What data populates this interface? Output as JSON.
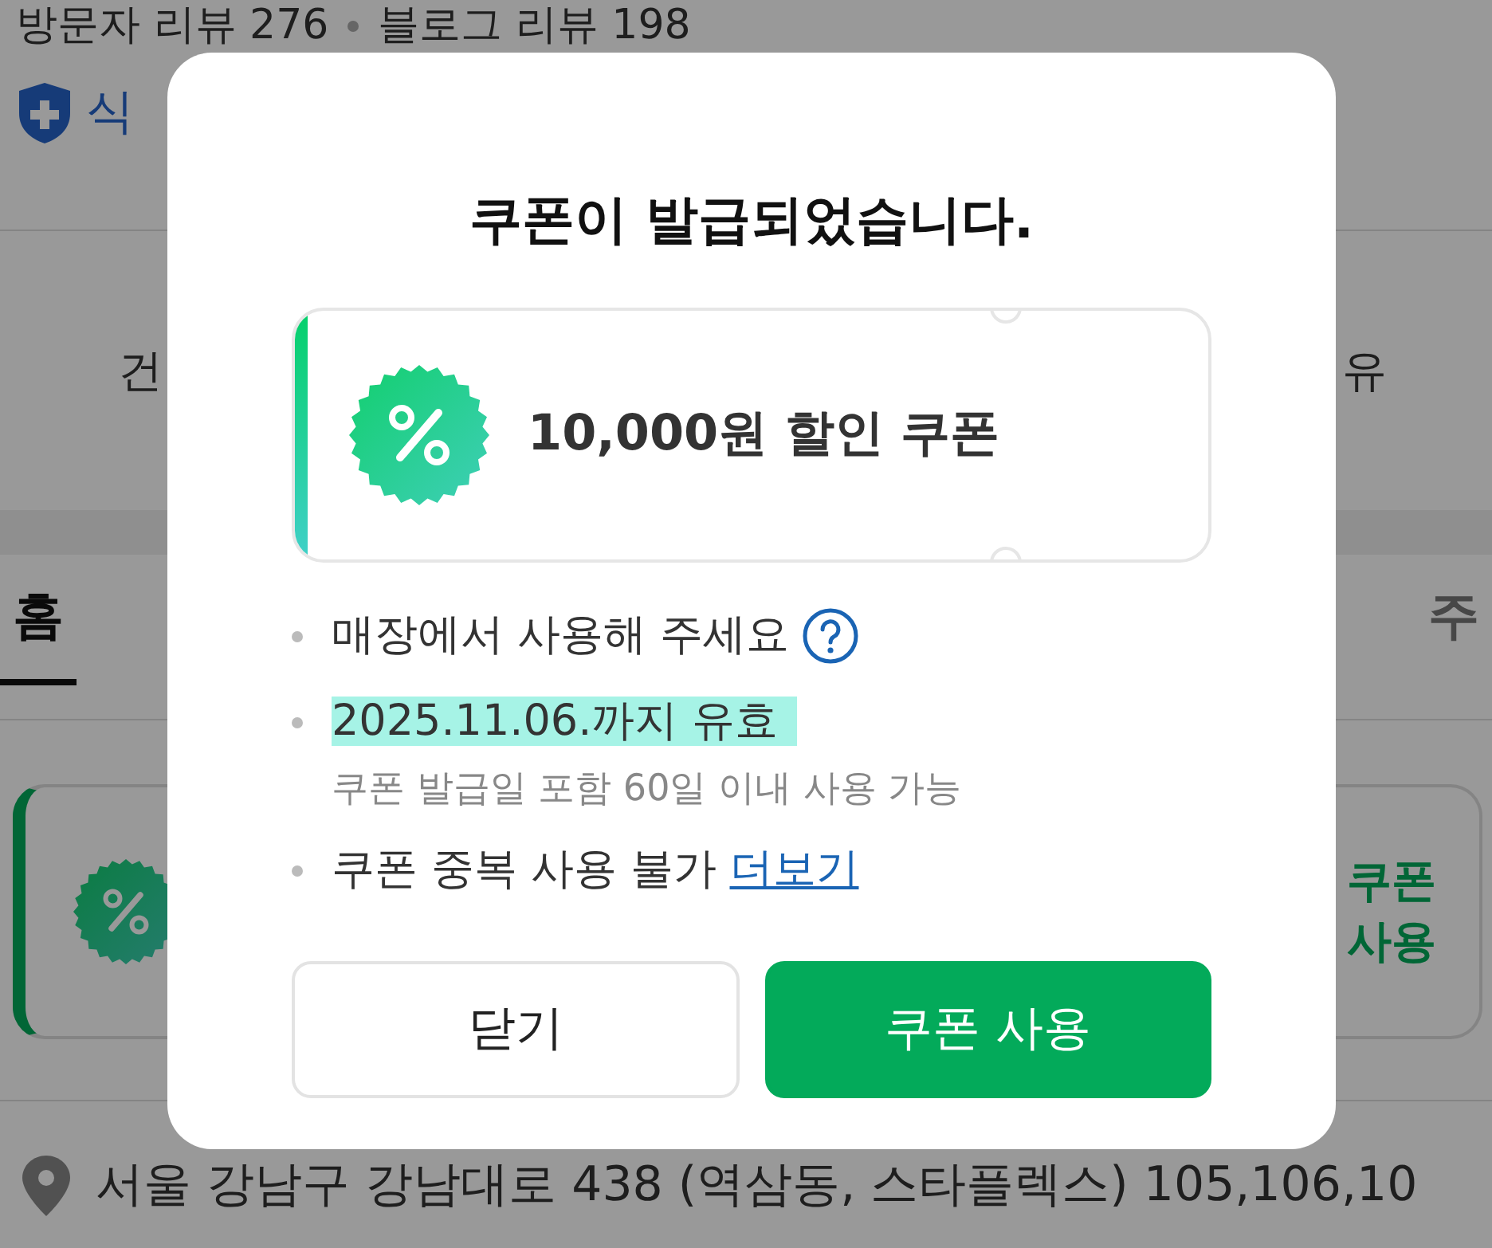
{
  "page": {
    "reviews": [
      "방문자 리뷰 276",
      "블로그 리뷰 198"
    ],
    "certification": "식",
    "info_left": "건",
    "info_right": "유",
    "tabs": [
      {
        "label": "홈",
        "selected": true
      },
      {
        "label": "주",
        "selected": false
      }
    ],
    "coupon_card": {
      "action": "쿠폰 사용"
    },
    "address": "서울 강남구 강남대로 438 (역삼동, 스타플렉스) 105,106,10"
  },
  "dialog": {
    "title": "쿠폰이 발급되었습니다.",
    "coupon": {
      "name": "10,000원 할인 쿠폰"
    },
    "notes": [
      {
        "kind": "help",
        "text": "매장에서 사용해 주세요"
      },
      {
        "kind": "highlight",
        "text": "2025.11.06.까지 유효",
        "subtext": "쿠폰 발급일 포함 60일 이내 사용 가능"
      },
      {
        "kind": "link",
        "text": "쿠폰 중복 사용 불가",
        "link": "더보기"
      }
    ],
    "buttons": [
      {
        "label": "닫기",
        "kind": "secondary"
      },
      {
        "label": "쿠폰 사용",
        "kind": "primary"
      }
    ]
  }
}
